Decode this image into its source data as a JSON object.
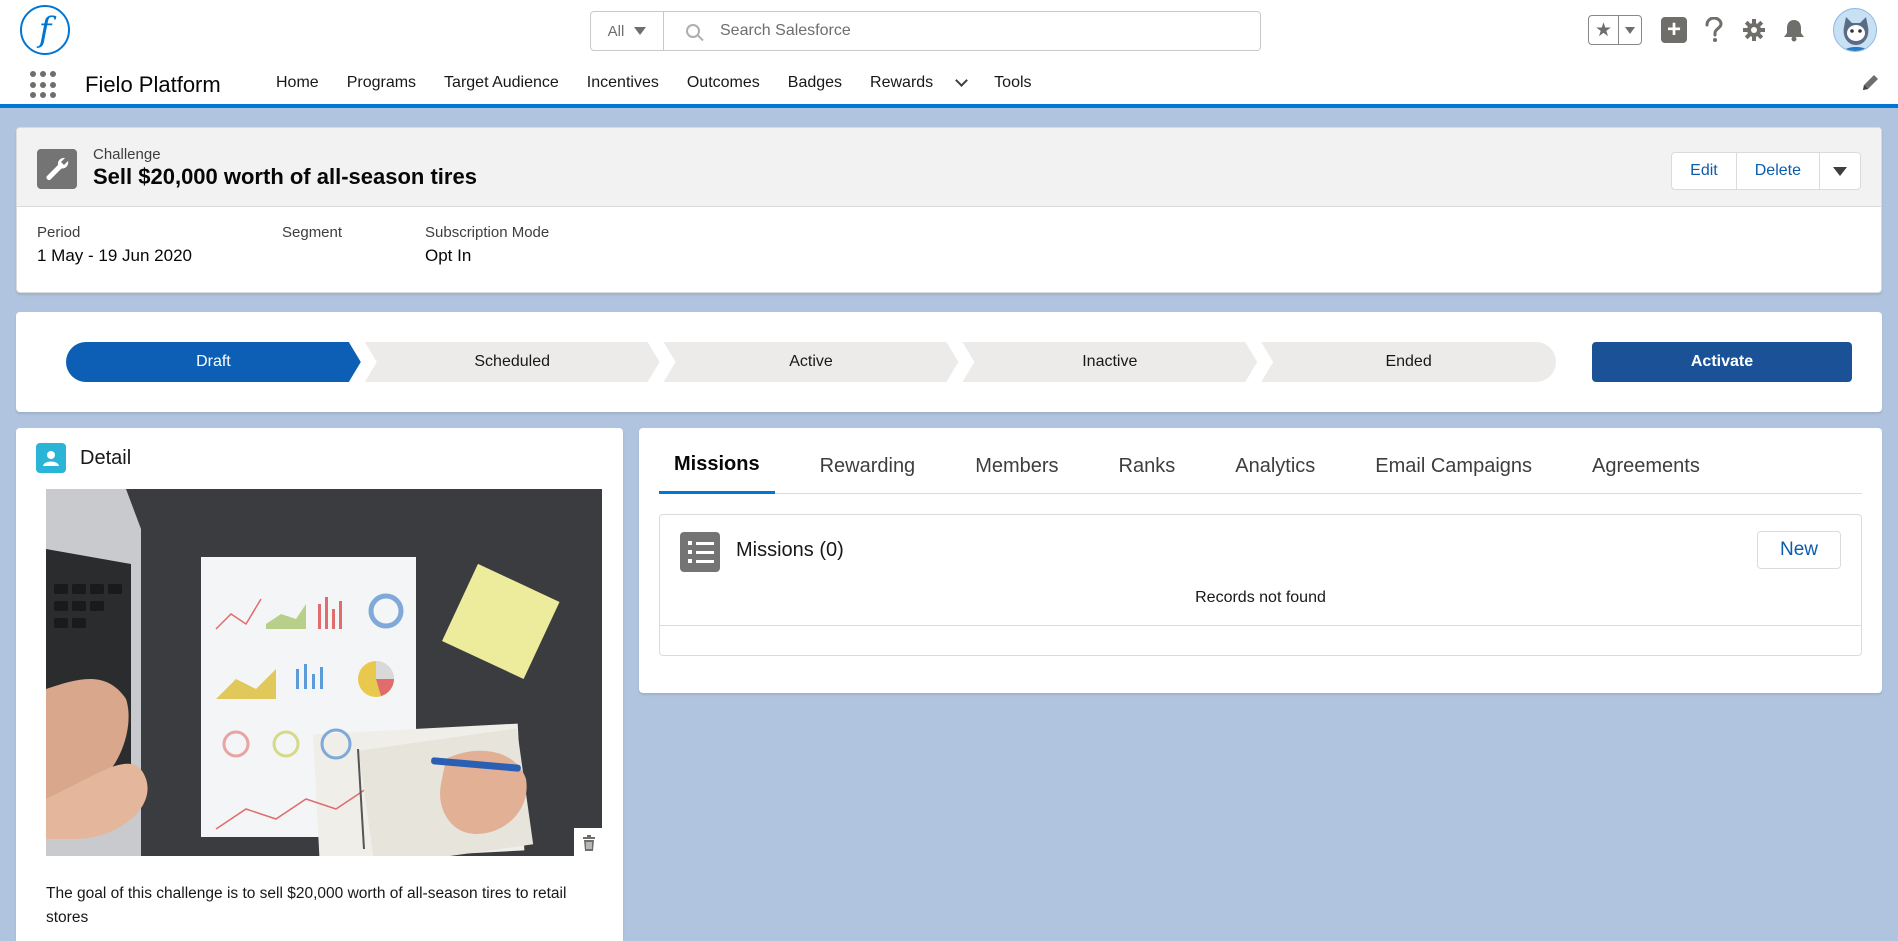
{
  "header": {
    "logo_letter": "f",
    "search_scope": "All",
    "search_placeholder": "Search Salesforce",
    "icons": [
      "favorites-star-icon",
      "favorites-dropdown-icon",
      "global-actions-icon",
      "help-icon",
      "setup-gear-icon",
      "notifications-bell-icon",
      "user-avatar"
    ]
  },
  "nav": {
    "app_name": "Fielo Platform",
    "items": [
      {
        "label": "Home"
      },
      {
        "label": "Programs"
      },
      {
        "label": "Target Audience"
      },
      {
        "label": "Incentives"
      },
      {
        "label": "Outcomes"
      },
      {
        "label": "Badges"
      },
      {
        "label": "Rewards",
        "has_dropdown": true
      },
      {
        "label": "Tools"
      }
    ]
  },
  "record": {
    "object_type": "Challenge",
    "title": "Sell $20,000 worth of all-season tires",
    "actions": {
      "edit": "Edit",
      "delete": "Delete"
    },
    "fields": [
      {
        "label": "Period",
        "value": "1 May - 19 Jun 2020"
      },
      {
        "label": "Segment",
        "value": ""
      },
      {
        "label": "Subscription Mode",
        "value": "Opt In"
      }
    ]
  },
  "path": {
    "steps": [
      "Draft",
      "Scheduled",
      "Active",
      "Inactive",
      "Ended"
    ],
    "current_step": "Draft",
    "action_label": "Activate"
  },
  "detail": {
    "title": "Detail",
    "image_alt": "hands working on a laptop and charts on paper",
    "description": "The goal of this challenge is to sell $20,000 worth of all-season tires to retail stores"
  },
  "tabs": {
    "items": [
      "Missions",
      "Rewarding",
      "Members",
      "Ranks",
      "Analytics",
      "Email Campaigns",
      "Agreements"
    ],
    "active": "Missions"
  },
  "related_list": {
    "title": "Missions (0)",
    "new_label": "New",
    "empty_message": "Records not found"
  },
  "colors": {
    "brand": "#0176d3",
    "path_current": "#0c5fb4",
    "activate_button": "#1b5297",
    "page_background": "#b0c4df"
  }
}
